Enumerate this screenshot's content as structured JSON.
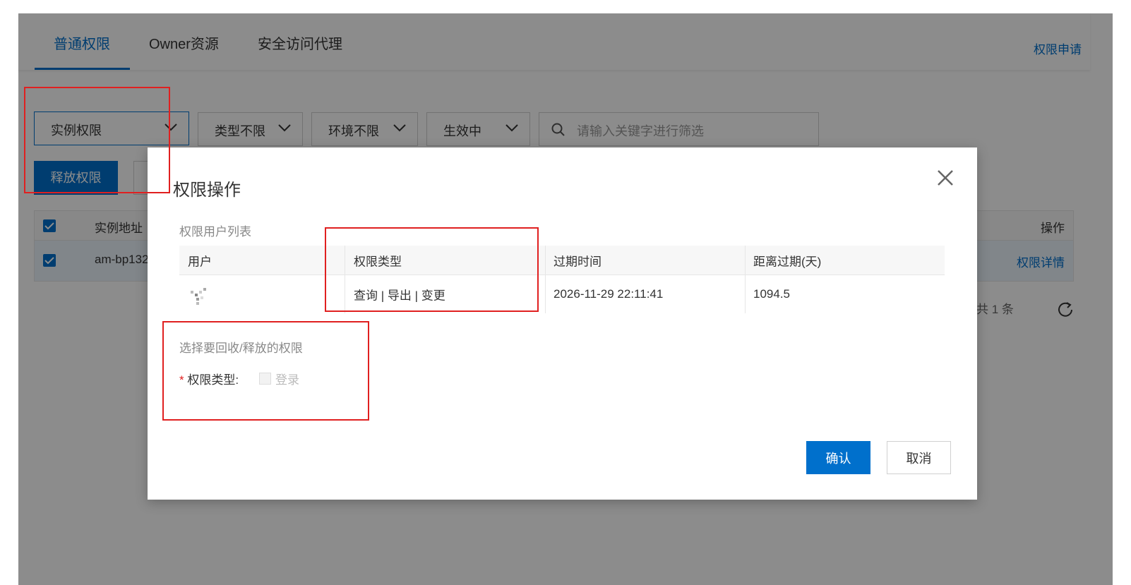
{
  "tabs": [
    "普通权限",
    "Owner资源",
    "安全访问代理"
  ],
  "apply_link": "权限申请",
  "filters": {
    "instance": "实例权限",
    "type": "类型不限",
    "env": "环境不限",
    "status": "生效中",
    "search_placeholder": "请输入关键字进行筛选"
  },
  "release_button": "释放权限",
  "bg_table": {
    "col_instance": "实例地址",
    "col_action": "操作",
    "row_instance": "am-bp132",
    "row_action": "权限详情"
  },
  "total_text": "共 1 条",
  "dialog": {
    "title": "权限操作",
    "user_list_label": "权限用户列表",
    "columns": [
      "用户",
      "权限类型",
      "过期时间",
      "距离过期(天)"
    ],
    "row": {
      "perm_type": "查询 | 导出 | 变更",
      "expire_time": "2026-11-29 22:11:41",
      "days_left": "1094.5"
    },
    "select_label": "选择要回收/释放的权限",
    "perm_type_label": "权限类型:",
    "required_mark": "*",
    "login_option": "登录",
    "confirm": "确认",
    "cancel": "取消"
  },
  "colors": {
    "accent": "#0070cc",
    "annotation": "#e02020"
  }
}
